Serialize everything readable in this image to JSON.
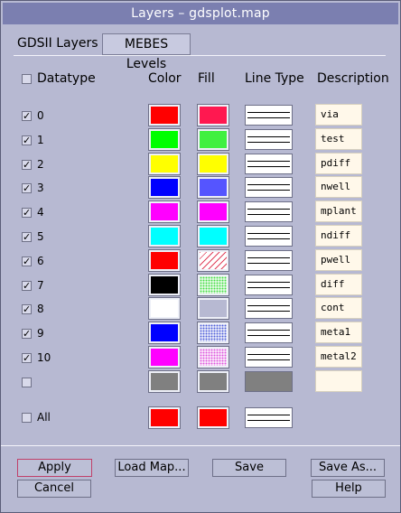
{
  "window": {
    "title": "Layers – gdsplot.map"
  },
  "tabs": [
    {
      "label": "GDSII Layers"
    },
    {
      "label": "MEBES Levels"
    }
  ],
  "headers": {
    "datatype": "Datatype",
    "color": "Color",
    "fill": "Fill",
    "line_type": "Line Type",
    "description": "Description"
  },
  "rows": [
    {
      "label": "0",
      "checked": true,
      "color": "#ff0000",
      "fill": "#ff1850",
      "fill_pattern": "solid",
      "description": "via"
    },
    {
      "label": "1",
      "checked": true,
      "color": "#00ff00",
      "fill": "#40f040",
      "fill_pattern": "solid",
      "description": "test"
    },
    {
      "label": "2",
      "checked": true,
      "color": "#ffff00",
      "fill": "#ffff00",
      "fill_pattern": "solid",
      "description": "pdiff"
    },
    {
      "label": "3",
      "checked": true,
      "color": "#0000ff",
      "fill": "#5555ff",
      "fill_pattern": "solid",
      "description": "nwell"
    },
    {
      "label": "4",
      "checked": true,
      "color": "#ff00ff",
      "fill": "#ff00ff",
      "fill_pattern": "solid",
      "description": "mplant"
    },
    {
      "label": "5",
      "checked": true,
      "color": "#00ffff",
      "fill": "#00ffff",
      "fill_pattern": "solid",
      "description": "ndiff"
    },
    {
      "label": "6",
      "checked": true,
      "color": "#ff0000",
      "fill": "#e0405a",
      "fill_pattern": "hatch",
      "description": "pwell"
    },
    {
      "label": "7",
      "checked": true,
      "color": "#000000",
      "fill": "#44dd44",
      "fill_pattern": "dots",
      "description": "diff"
    },
    {
      "label": "8",
      "checked": true,
      "color": "#ffffff",
      "fill": "#d49a2a",
      "fill_pattern": "cross",
      "description": "cont"
    },
    {
      "label": "9",
      "checked": true,
      "color": "#0000ff",
      "fill": "#4f5fd8",
      "fill_pattern": "dots",
      "description": "meta1"
    },
    {
      "label": "10",
      "checked": true,
      "color": "#ff00ff",
      "fill": "#dd55dd",
      "fill_pattern": "dots",
      "description": "metal2"
    },
    {
      "label": "",
      "checked": false,
      "color": "#808080",
      "fill": "#808080",
      "fill_pattern": "solid",
      "description": ""
    }
  ],
  "all_row": {
    "label": "All",
    "checked": false,
    "color": "#ff0000",
    "fill": "#ff0000"
  },
  "buttons": {
    "apply": "Apply",
    "load_map": "Load Map...",
    "save": "Save",
    "save_as": "Save As...",
    "cancel": "Cancel",
    "help": "Help"
  }
}
